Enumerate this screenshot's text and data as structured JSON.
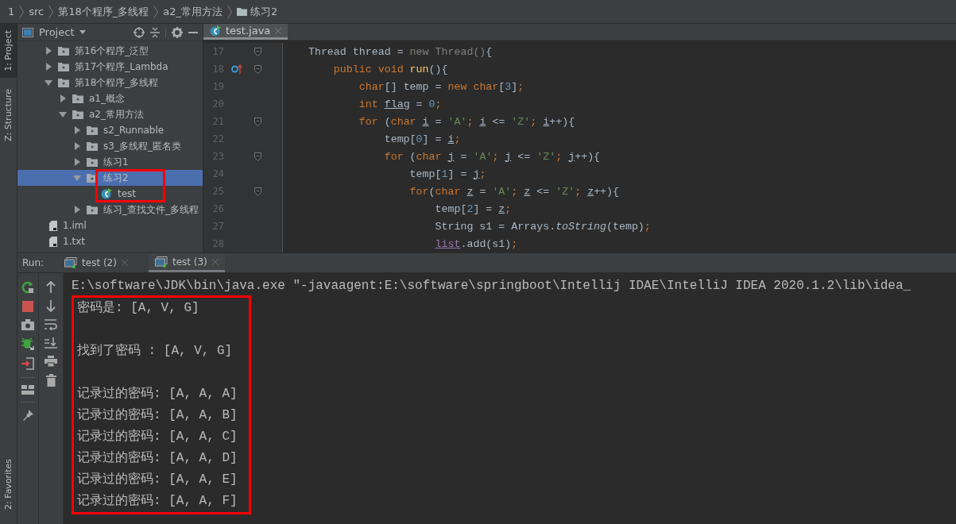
{
  "breadcrumb": [
    "1",
    "src",
    "第18个程序_多线程",
    "a2_常用方法",
    "练习2"
  ],
  "side_tabs": [
    {
      "label": "1: Project",
      "selected": true
    },
    {
      "label": "Z: Structure",
      "selected": false
    },
    {
      "label": "2: Favorites",
      "selected": false
    }
  ],
  "project_panel": {
    "title": "Project"
  },
  "tree": {
    "items": [
      {
        "label": "第16个程序_泛型",
        "kind": "folder",
        "expanded": false,
        "selected": false,
        "highlighted": false
      },
      {
        "label": "第17个程序_Lambda",
        "kind": "folder",
        "expanded": false,
        "selected": false,
        "highlighted": false
      },
      {
        "label": "第18个程序_多线程",
        "kind": "folder",
        "expanded": true,
        "selected": false,
        "highlighted": false,
        "children": [
          {
            "label": "a1_概念",
            "kind": "folder",
            "expanded": false,
            "selected": false,
            "highlighted": false
          },
          {
            "label": "a2_常用方法",
            "kind": "folder",
            "expanded": true,
            "selected": false,
            "highlighted": false,
            "children": [
              {
                "label": "s2_Runnable",
                "kind": "folder",
                "expanded": false,
                "selected": false,
                "highlighted": false
              },
              {
                "label": "s3_多线程_匿名类",
                "kind": "folder",
                "expanded": false,
                "selected": false,
                "highlighted": false
              },
              {
                "label": "练习1",
                "kind": "folder",
                "expanded": false,
                "selected": false,
                "highlighted": false
              },
              {
                "label": "练习2",
                "kind": "folder",
                "expanded": true,
                "selected": true,
                "highlighted": true,
                "children": [
                  {
                    "label": "test",
                    "kind": "class",
                    "selected": false,
                    "highlighted": false
                  }
                ]
              },
              {
                "label": "练习_查找文件_多线程",
                "kind": "folder",
                "expanded": false,
                "selected": false,
                "highlighted": false
              }
            ]
          }
        ]
      },
      {
        "label": "1.iml",
        "kind": "file",
        "selected": false,
        "highlighted": false
      },
      {
        "label": "1.txt",
        "kind": "file",
        "selected": false,
        "highlighted": false
      }
    ]
  },
  "editor": {
    "tab": "test.java",
    "lines": [
      {
        "number": "17",
        "fold": true,
        "marker": false,
        "tokens": [
          {
            "kind": "plain",
            "t": "    Thread thread = "
          },
          {
            "kind": "dim",
            "t": "new Thread()"
          },
          {
            "kind": "plain",
            "t": "{"
          }
        ]
      },
      {
        "number": "18",
        "fold": true,
        "marker": true,
        "tokens": [
          {
            "kind": "kw",
            "t": "        public void "
          },
          {
            "kind": "decl",
            "t": "run"
          },
          {
            "kind": "plain",
            "t": "(){"
          }
        ]
      },
      {
        "number": "19",
        "fold": false,
        "marker": false,
        "tokens": [
          {
            "kind": "kw",
            "t": "            char"
          },
          {
            "kind": "plain",
            "t": "[] temp = "
          },
          {
            "kind": "kw",
            "t": "new char"
          },
          {
            "kind": "plain",
            "t": "["
          },
          {
            "kind": "num",
            "t": "3"
          },
          {
            "kind": "plain",
            "t": "]"
          },
          {
            "kind": "kw",
            "t": ";"
          }
        ]
      },
      {
        "number": "20",
        "fold": false,
        "marker": false,
        "tokens": [
          {
            "kind": "kw",
            "t": "            int "
          },
          {
            "kind": "var",
            "t": "flag"
          },
          {
            "kind": "plain",
            "t": " = "
          },
          {
            "kind": "num",
            "t": "0"
          },
          {
            "kind": "kw",
            "t": ";"
          }
        ]
      },
      {
        "number": "21",
        "fold": true,
        "marker": false,
        "tokens": [
          {
            "kind": "kw",
            "t": "            for "
          },
          {
            "kind": "plain",
            "t": "("
          },
          {
            "kind": "kw",
            "t": "char "
          },
          {
            "kind": "var",
            "t": "i"
          },
          {
            "kind": "plain",
            "t": " = "
          },
          {
            "kind": "str",
            "t": "'A'"
          },
          {
            "kind": "kw",
            "t": "; "
          },
          {
            "kind": "var",
            "t": "i"
          },
          {
            "kind": "plain",
            "t": " <= "
          },
          {
            "kind": "str",
            "t": "'Z'"
          },
          {
            "kind": "kw",
            "t": "; "
          },
          {
            "kind": "var",
            "t": "i"
          },
          {
            "kind": "plain",
            "t": "++){"
          }
        ]
      },
      {
        "number": "22",
        "fold": false,
        "marker": false,
        "tokens": [
          {
            "kind": "plain",
            "t": "                temp["
          },
          {
            "kind": "num",
            "t": "0"
          },
          {
            "kind": "plain",
            "t": "] = "
          },
          {
            "kind": "var",
            "t": "i"
          },
          {
            "kind": "kw",
            "t": ";"
          }
        ]
      },
      {
        "number": "23",
        "fold": true,
        "marker": false,
        "tokens": [
          {
            "kind": "kw",
            "t": "                for "
          },
          {
            "kind": "plain",
            "t": "("
          },
          {
            "kind": "kw",
            "t": "char "
          },
          {
            "kind": "var",
            "t": "j"
          },
          {
            "kind": "plain",
            "t": " = "
          },
          {
            "kind": "str",
            "t": "'A'"
          },
          {
            "kind": "kw",
            "t": "; "
          },
          {
            "kind": "var",
            "t": "j"
          },
          {
            "kind": "plain",
            "t": " <= "
          },
          {
            "kind": "str",
            "t": "'Z'"
          },
          {
            "kind": "kw",
            "t": "; "
          },
          {
            "kind": "var",
            "t": "j"
          },
          {
            "kind": "plain",
            "t": "++){"
          }
        ]
      },
      {
        "number": "24",
        "fold": false,
        "marker": false,
        "tokens": [
          {
            "kind": "plain",
            "t": "                    temp["
          },
          {
            "kind": "num",
            "t": "1"
          },
          {
            "kind": "plain",
            "t": "] = "
          },
          {
            "kind": "var",
            "t": "j"
          },
          {
            "kind": "kw",
            "t": ";"
          }
        ]
      },
      {
        "number": "25",
        "fold": true,
        "marker": false,
        "tokens": [
          {
            "kind": "kw",
            "t": "                    for"
          },
          {
            "kind": "plain",
            "t": "("
          },
          {
            "kind": "kw",
            "t": "char "
          },
          {
            "kind": "var",
            "t": "z"
          },
          {
            "kind": "plain",
            "t": " = "
          },
          {
            "kind": "str",
            "t": "'A'"
          },
          {
            "kind": "kw",
            "t": "; "
          },
          {
            "kind": "var",
            "t": "z"
          },
          {
            "kind": "plain",
            "t": " <= "
          },
          {
            "kind": "str",
            "t": "'Z'"
          },
          {
            "kind": "kw",
            "t": "; "
          },
          {
            "kind": "var",
            "t": "z"
          },
          {
            "kind": "plain",
            "t": "++){"
          }
        ]
      },
      {
        "number": "26",
        "fold": false,
        "marker": false,
        "tokens": [
          {
            "kind": "plain",
            "t": "                        temp["
          },
          {
            "kind": "num",
            "t": "2"
          },
          {
            "kind": "plain",
            "t": "] = "
          },
          {
            "kind": "var",
            "t": "z"
          },
          {
            "kind": "kw",
            "t": ";"
          }
        ]
      },
      {
        "number": "27",
        "fold": false,
        "marker": false,
        "tokens": [
          {
            "kind": "plain",
            "t": "                        String s1 = Arrays."
          },
          {
            "kind": "fn",
            "t": "toString"
          },
          {
            "kind": "plain",
            "t": "(temp)"
          },
          {
            "kind": "kw",
            "t": ";"
          }
        ]
      },
      {
        "number": "28",
        "fold": false,
        "marker": false,
        "tokens": [
          {
            "kind": "field",
            "t": "                        list"
          },
          {
            "kind": "plain",
            "t": ".add(s1)"
          },
          {
            "kind": "kw",
            "t": ";"
          }
        ]
      }
    ]
  },
  "run": {
    "label": "Run:",
    "tabs": [
      {
        "label": "test (2)",
        "selected": false
      },
      {
        "label": "test (3)",
        "selected": true
      }
    ],
    "command": "E:\\software\\JDK\\bin\\java.exe \"-javaagent:E:\\software\\springboot\\Intellij IDAE\\IntelliJ IDEA 2020.1.2\\lib\\idea_",
    "output_blocks": [
      [
        "密码是: [A, V, G]"
      ],
      [
        "找到了密码 : [A, V, G]"
      ],
      [
        "记录过的密码: [A, A, A]",
        "记录过的密码: [A, A, B]",
        "记录过的密码: [A, A, C]",
        "记录过的密码: [A, A, D]",
        "记录过的密码: [A, A, E]",
        "记录过的密码: [A, A, F]"
      ]
    ]
  }
}
